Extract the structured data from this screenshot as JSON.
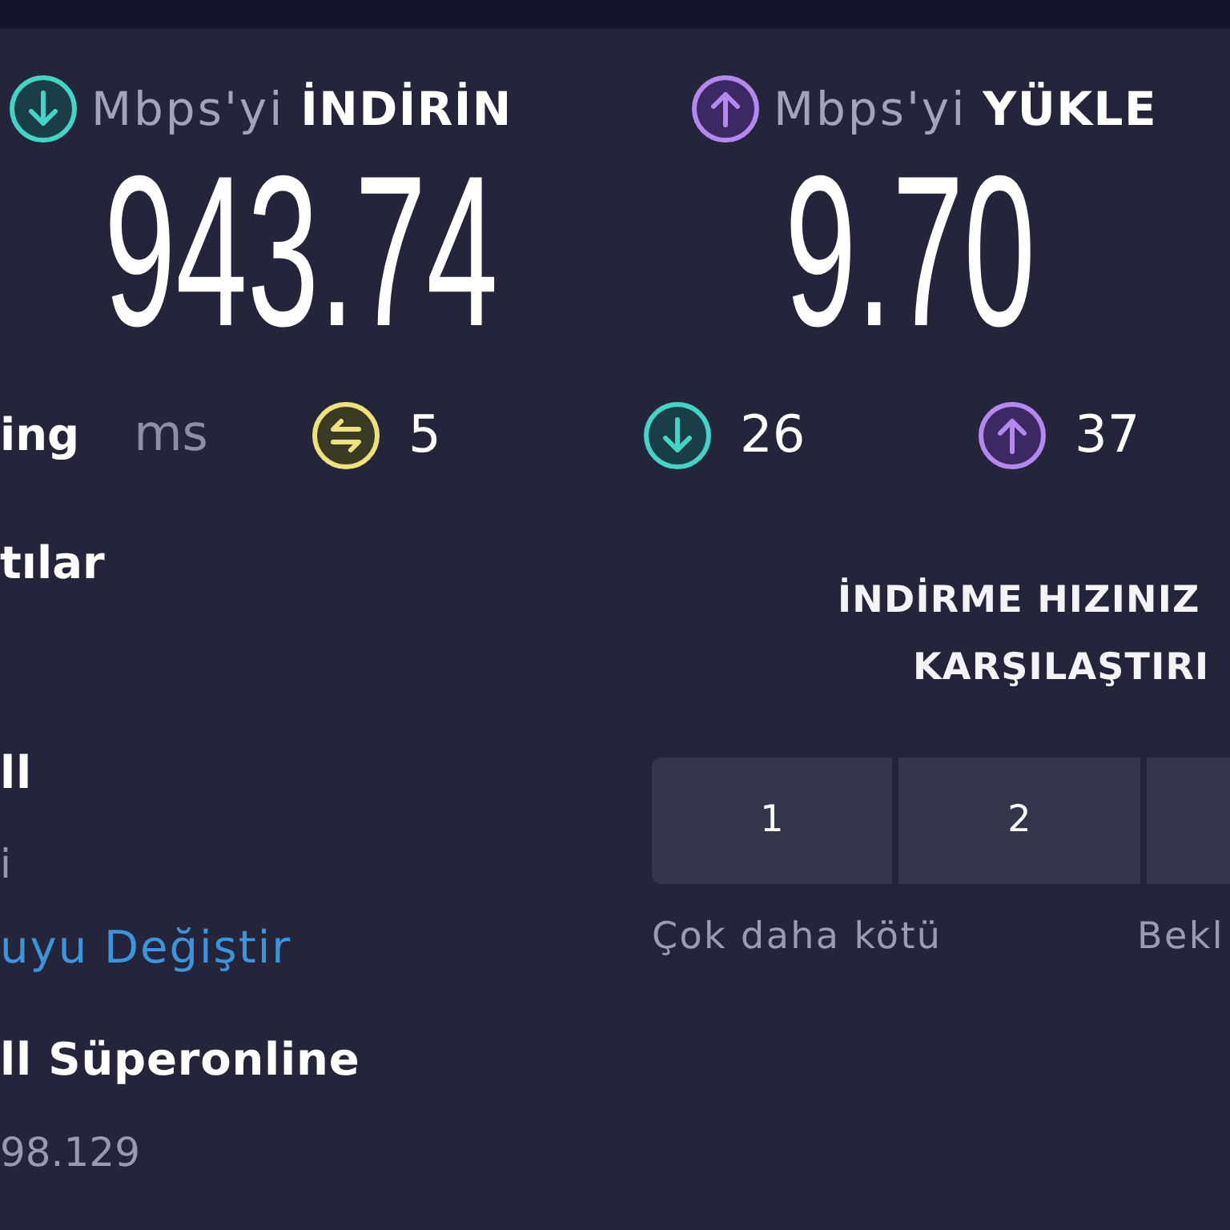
{
  "results": [
    {
      "kind": "download",
      "unit": "Mbps'yi",
      "label": "İNDİRİN",
      "value": "943.74"
    },
    {
      "kind": "upload",
      "unit": "Mbps'yi",
      "label": "YÜKLE",
      "value": "9.70"
    }
  ],
  "latency": {
    "label": "ing",
    "unit": "ms",
    "stats": [
      {
        "kind": "jitter",
        "value": "5"
      },
      {
        "kind": "download",
        "value": "26"
      },
      {
        "kind": "upload",
        "value": "37"
      }
    ]
  },
  "connections": {
    "title": "tılar",
    "items": [
      {
        "kind": "name",
        "text": "ll"
      },
      {
        "kind": "detail",
        "text": "i"
      },
      {
        "kind": "link",
        "text": "uyu Değiştir"
      },
      {
        "kind": "name",
        "text": "ll Süperonline"
      },
      {
        "kind": "detail",
        "text": "98.129"
      }
    ]
  },
  "rating": {
    "title_lines": [
      "İNDİRME HIZINIZ",
      "KARŞILAŞTIRI"
    ],
    "options": [
      {
        "label": "1",
        "selected": false
      },
      {
        "label": "2",
        "selected": false
      },
      {
        "selected": false
      }
    ],
    "scale_labels": [
      "Çok daha kötü",
      "Bekl"
    ]
  }
}
